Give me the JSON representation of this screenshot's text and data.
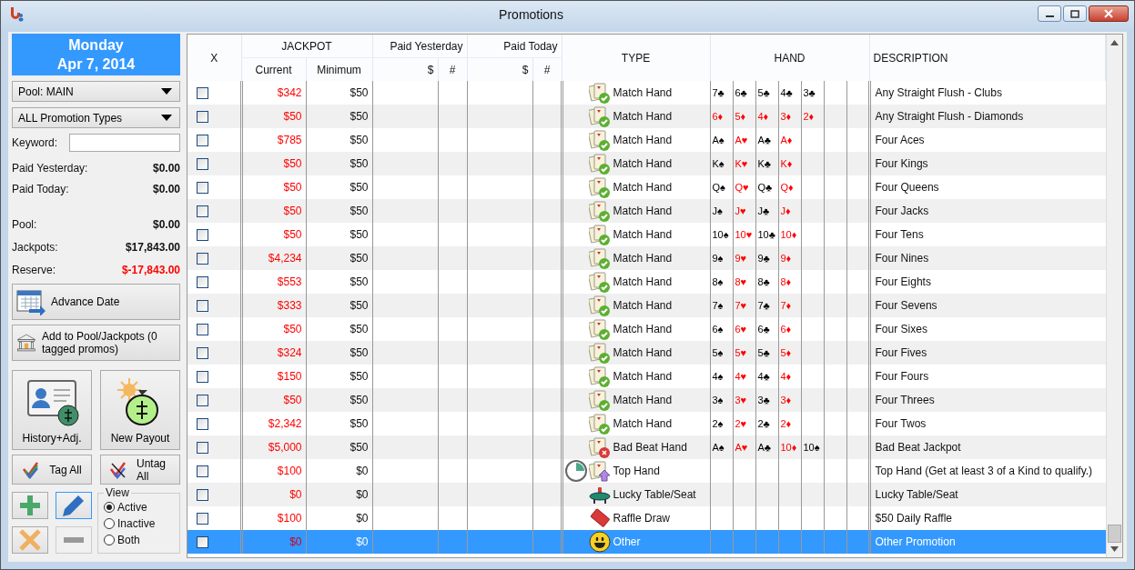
{
  "window": {
    "title": "Promotions"
  },
  "date": {
    "day": "Monday",
    "date": "Apr 7, 2014"
  },
  "filters": {
    "pool": "Pool: MAIN",
    "types": "ALL Promotion Types",
    "keyword_label": "Keyword:"
  },
  "paid": [
    {
      "label": "Paid Yesterday:",
      "value": "$0.00",
      "negative": false
    },
    {
      "label": "Paid Today:",
      "value": "$0.00",
      "negative": false
    }
  ],
  "balances": [
    {
      "label": "Pool:",
      "value": "$0.00",
      "negative": false
    },
    {
      "label": "Jackpots:",
      "value": "$17,843.00",
      "negative": false
    },
    {
      "label": "Reserve:",
      "value": "$-17,843.00",
      "negative": true
    }
  ],
  "buttons": {
    "advance": "Advance Date",
    "add_pool": "Add to Pool/Jackpots (0 tagged promos)",
    "history": "History+Adj.",
    "payout": "New Payout",
    "tag_all": "Tag All",
    "untag_all": "Untag All"
  },
  "tools": [
    {
      "kind": "add",
      "disabled": false,
      "focused": false
    },
    {
      "kind": "edit",
      "disabled": false,
      "focused": true
    },
    {
      "kind": "delete",
      "disabled": false,
      "focused": false
    },
    {
      "kind": "remove",
      "disabled": true,
      "focused": false
    }
  ],
  "view": {
    "label": "View",
    "options": [
      {
        "label": "Active",
        "selected": true
      },
      {
        "label": "Inactive",
        "selected": false
      },
      {
        "label": "Both",
        "selected": false
      }
    ]
  },
  "table": {
    "headers": {
      "x": "X",
      "jackpot": "JACKPOT",
      "current": "Current",
      "minimum": "Minimum",
      "paid_yesterday": "Paid Yesterday",
      "paid_today": "Paid Today",
      "amount": "$",
      "count": "#",
      "type": "TYPE",
      "hand": "HAND",
      "description": "DESCRIPTION"
    },
    "rows": [
      {
        "checked": false,
        "selected": false,
        "current": "$342",
        "minimum": "$50",
        "kind": "match",
        "type": "Match Hand",
        "timed": false,
        "hand": [
          {
            "card": "7♣",
            "color": "#000000"
          },
          {
            "card": "6♣",
            "color": "#000000"
          },
          {
            "card": "5♣",
            "color": "#000000"
          },
          {
            "card": "4♣",
            "color": "#000000"
          },
          {
            "card": "3♣",
            "color": "#000000"
          }
        ],
        "description": "Any Straight Flush - Clubs"
      },
      {
        "checked": false,
        "selected": false,
        "current": "$50",
        "minimum": "$50",
        "kind": "match",
        "type": "Match Hand",
        "timed": false,
        "hand": [
          {
            "card": "6♦",
            "color": "#ff0000"
          },
          {
            "card": "5♦",
            "color": "#ff0000"
          },
          {
            "card": "4♦",
            "color": "#ff0000"
          },
          {
            "card": "3♦",
            "color": "#ff0000"
          },
          {
            "card": "2♦",
            "color": "#ff0000"
          }
        ],
        "description": "Any Straight Flush - Diamonds"
      },
      {
        "checked": false,
        "selected": false,
        "current": "$785",
        "minimum": "$50",
        "kind": "match",
        "type": "Match Hand",
        "timed": false,
        "hand": [
          {
            "card": "A♠",
            "color": "#000000"
          },
          {
            "card": "A♥",
            "color": "#ff0000"
          },
          {
            "card": "A♣",
            "color": "#000000"
          },
          {
            "card": "A♦",
            "color": "#ff0000"
          }
        ],
        "description": "Four Aces"
      },
      {
        "checked": false,
        "selected": false,
        "current": "$50",
        "minimum": "$50",
        "kind": "match",
        "type": "Match Hand",
        "timed": false,
        "hand": [
          {
            "card": "K♠",
            "color": "#000000"
          },
          {
            "card": "K♥",
            "color": "#ff0000"
          },
          {
            "card": "K♣",
            "color": "#000000"
          },
          {
            "card": "K♦",
            "color": "#ff0000"
          }
        ],
        "description": "Four Kings"
      },
      {
        "checked": false,
        "selected": false,
        "current": "$50",
        "minimum": "$50",
        "kind": "match",
        "type": "Match Hand",
        "timed": false,
        "hand": [
          {
            "card": "Q♠",
            "color": "#000000"
          },
          {
            "card": "Q♥",
            "color": "#ff0000"
          },
          {
            "card": "Q♣",
            "color": "#000000"
          },
          {
            "card": "Q♦",
            "color": "#ff0000"
          }
        ],
        "description": "Four Queens"
      },
      {
        "checked": false,
        "selected": false,
        "current": "$50",
        "minimum": "$50",
        "kind": "match",
        "type": "Match Hand",
        "timed": false,
        "hand": [
          {
            "card": "J♠",
            "color": "#000000"
          },
          {
            "card": "J♥",
            "color": "#ff0000"
          },
          {
            "card": "J♣",
            "color": "#000000"
          },
          {
            "card": "J♦",
            "color": "#ff0000"
          }
        ],
        "description": "Four Jacks"
      },
      {
        "checked": false,
        "selected": false,
        "current": "$50",
        "minimum": "$50",
        "kind": "match",
        "type": "Match Hand",
        "timed": false,
        "hand": [
          {
            "card": "10♠",
            "color": "#000000"
          },
          {
            "card": "10♥",
            "color": "#ff0000"
          },
          {
            "card": "10♣",
            "color": "#000000"
          },
          {
            "card": "10♦",
            "color": "#ff0000"
          }
        ],
        "description": "Four Tens"
      },
      {
        "checked": false,
        "selected": false,
        "current": "$4,234",
        "minimum": "$50",
        "kind": "match",
        "type": "Match Hand",
        "timed": false,
        "hand": [
          {
            "card": "9♠",
            "color": "#000000"
          },
          {
            "card": "9♥",
            "color": "#ff0000"
          },
          {
            "card": "9♣",
            "color": "#000000"
          },
          {
            "card": "9♦",
            "color": "#ff0000"
          }
        ],
        "description": "Four Nines"
      },
      {
        "checked": false,
        "selected": false,
        "current": "$553",
        "minimum": "$50",
        "kind": "match",
        "type": "Match Hand",
        "timed": false,
        "hand": [
          {
            "card": "8♠",
            "color": "#000000"
          },
          {
            "card": "8♥",
            "color": "#ff0000"
          },
          {
            "card": "8♣",
            "color": "#000000"
          },
          {
            "card": "8♦",
            "color": "#ff0000"
          }
        ],
        "description": "Four Eights"
      },
      {
        "checked": false,
        "selected": false,
        "current": "$333",
        "minimum": "$50",
        "kind": "match",
        "type": "Match Hand",
        "timed": false,
        "hand": [
          {
            "card": "7♠",
            "color": "#000000"
          },
          {
            "card": "7♥",
            "color": "#ff0000"
          },
          {
            "card": "7♣",
            "color": "#000000"
          },
          {
            "card": "7♦",
            "color": "#ff0000"
          }
        ],
        "description": "Four Sevens"
      },
      {
        "checked": false,
        "selected": false,
        "current": "$50",
        "minimum": "$50",
        "kind": "match",
        "type": "Match Hand",
        "timed": false,
        "hand": [
          {
            "card": "6♠",
            "color": "#000000"
          },
          {
            "card": "6♥",
            "color": "#ff0000"
          },
          {
            "card": "6♣",
            "color": "#000000"
          },
          {
            "card": "6♦",
            "color": "#ff0000"
          }
        ],
        "description": "Four Sixes"
      },
      {
        "checked": false,
        "selected": false,
        "current": "$324",
        "minimum": "$50",
        "kind": "match",
        "type": "Match Hand",
        "timed": false,
        "hand": [
          {
            "card": "5♠",
            "color": "#000000"
          },
          {
            "card": "5♥",
            "color": "#ff0000"
          },
          {
            "card": "5♣",
            "color": "#000000"
          },
          {
            "card": "5♦",
            "color": "#ff0000"
          }
        ],
        "description": "Four Fives"
      },
      {
        "checked": false,
        "selected": false,
        "current": "$150",
        "minimum": "$50",
        "kind": "match",
        "type": "Match Hand",
        "timed": false,
        "hand": [
          {
            "card": "4♠",
            "color": "#000000"
          },
          {
            "card": "4♥",
            "color": "#ff0000"
          },
          {
            "card": "4♣",
            "color": "#000000"
          },
          {
            "card": "4♦",
            "color": "#ff0000"
          }
        ],
        "description": "Four Fours"
      },
      {
        "checked": false,
        "selected": false,
        "current": "$50",
        "minimum": "$50",
        "kind": "match",
        "type": "Match Hand",
        "timed": false,
        "hand": [
          {
            "card": "3♠",
            "color": "#000000"
          },
          {
            "card": "3♥",
            "color": "#ff0000"
          },
          {
            "card": "3♣",
            "color": "#000000"
          },
          {
            "card": "3♦",
            "color": "#ff0000"
          }
        ],
        "description": "Four Threes"
      },
      {
        "checked": false,
        "selected": false,
        "current": "$2,342",
        "minimum": "$50",
        "kind": "match",
        "type": "Match Hand",
        "timed": false,
        "hand": [
          {
            "card": "2♠",
            "color": "#000000"
          },
          {
            "card": "2♥",
            "color": "#ff0000"
          },
          {
            "card": "2♣",
            "color": "#000000"
          },
          {
            "card": "2♦",
            "color": "#ff0000"
          }
        ],
        "description": "Four Twos"
      },
      {
        "checked": false,
        "selected": false,
        "current": "$5,000",
        "minimum": "$50",
        "kind": "badbeat",
        "type": "Bad Beat Hand",
        "timed": false,
        "hand": [
          {
            "card": "A♠",
            "color": "#000000"
          },
          {
            "card": "A♥",
            "color": "#ff0000"
          },
          {
            "card": "A♣",
            "color": "#000000"
          },
          {
            "card": "10♦",
            "color": "#ff0000"
          },
          {
            "card": "10♠",
            "color": "#000000"
          }
        ],
        "description": "Bad Beat Jackpot"
      },
      {
        "checked": false,
        "selected": false,
        "current": "$100",
        "minimum": "$0",
        "kind": "top",
        "type": "Top Hand",
        "timed": true,
        "hand": [],
        "description": "Top Hand (Get at least 3 of a Kind to qualify.)"
      },
      {
        "checked": false,
        "selected": false,
        "current": "$0",
        "minimum": "$0",
        "kind": "table",
        "type": "Lucky Table/Seat",
        "timed": false,
        "hand": [],
        "description": "Lucky Table/Seat"
      },
      {
        "checked": false,
        "selected": false,
        "current": "$100",
        "minimum": "$0",
        "kind": "raffle",
        "type": "Raffle Draw",
        "timed": false,
        "hand": [],
        "description": "$50 Daily Raffle"
      },
      {
        "checked": false,
        "selected": true,
        "current": "$0",
        "minimum": "$0",
        "kind": "other",
        "type": "Other",
        "timed": false,
        "hand": [],
        "description": "Other Promotion"
      }
    ]
  }
}
